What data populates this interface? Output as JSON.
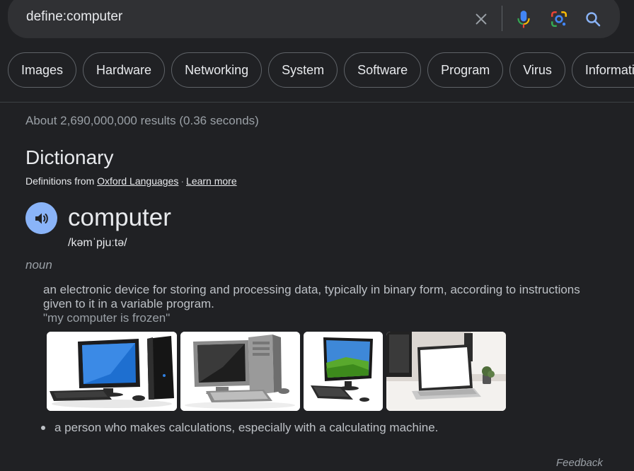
{
  "search": {
    "query": "define:computer"
  },
  "chips": [
    "Images",
    "Hardware",
    "Networking",
    "System",
    "Software",
    "Program",
    "Virus",
    "Information"
  ],
  "results": {
    "stats": "About 2,690,000,000 results (0.36 seconds)"
  },
  "dictionary": {
    "title": "Dictionary",
    "source_prefix": "Definitions from",
    "source_link": "Oxford Languages",
    "separator": "·",
    "learn_more": "Learn more",
    "word": "computer",
    "phonetic": "/kəmˈpjuːtə/",
    "part_of_speech": "noun",
    "definition_1": "an electronic device for storing and processing data, typically in binary form, according to instructions given to it in a variable program.",
    "example_1": "\"my computer is frozen\"",
    "definition_2": "a person who makes calculations, especially with a calculating machine.",
    "feedback": "Feedback"
  },
  "colors": {
    "background": "#202124",
    "searchbar": "#303134",
    "speaker": "#8ab4f8",
    "muted_text": "#9aa0a6"
  }
}
